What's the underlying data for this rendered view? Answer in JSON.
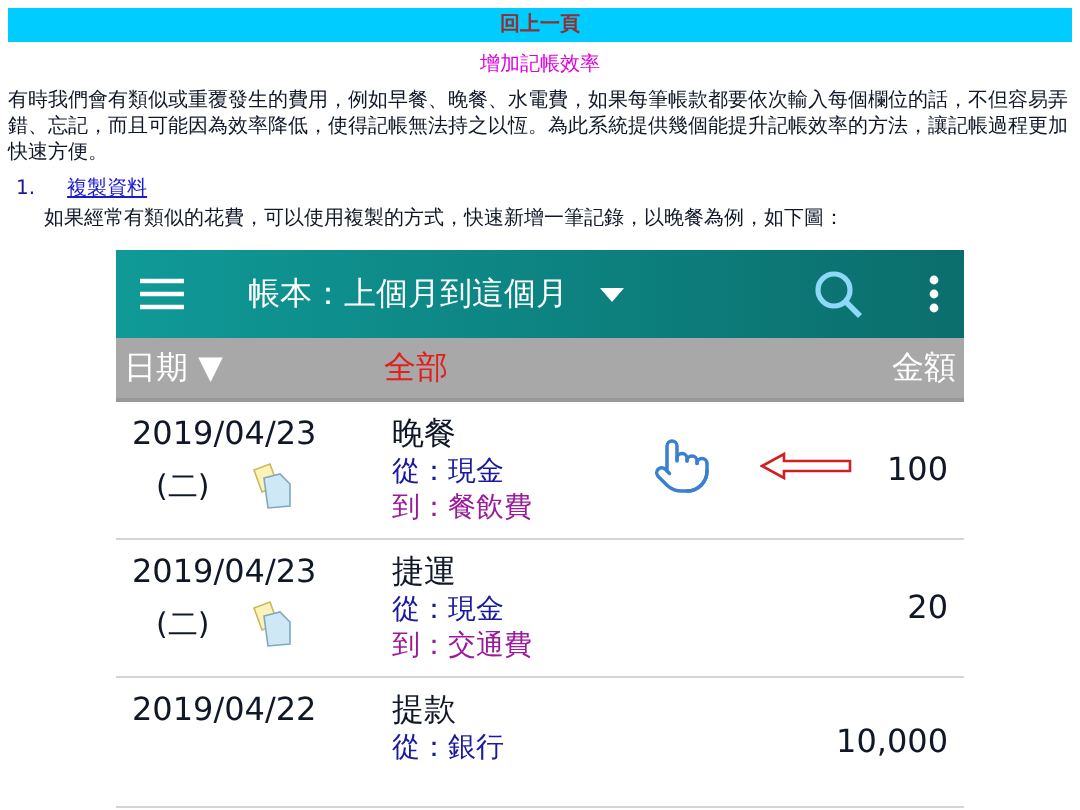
{
  "top_bar": {
    "label": "回上一頁"
  },
  "page_title": "增加記帳效率",
  "intro": "有時我們會有類似或重覆發生的費用，例如早餐、晚餐、水電費，如果每筆帳款都要依次輸入每個欄位的話，不但容易弄錯、忘記，而且可能因為效率降低，使得記帳無法持之以恆。為此系統提供幾個能提升記帳效率的方法，讓記帳過程更加快速方便。",
  "sections": [
    {
      "number": "1.",
      "title": "複製資料",
      "text": "如果經常有類似的花費，可以使用複製的方式，快速新增一筆記錄，以晚餐為例，如下圖："
    }
  ],
  "app": {
    "title": "帳本：上個月到這個月",
    "header": {
      "date": "日期 ▼",
      "filter": "全部",
      "amount": "金額"
    },
    "rows": [
      {
        "date": "2019/04/23",
        "weekday": "(二)",
        "name": "晚餐",
        "from": "從：現金",
        "to": "到：餐飲費",
        "amount": "100",
        "pointer": true
      },
      {
        "date": "2019/04/23",
        "weekday": "(二)",
        "name": "捷運",
        "from": "從：現金",
        "to": "到：交通費",
        "amount": "20",
        "pointer": false
      },
      {
        "date": "2019/04/22",
        "name": "提款",
        "from": "從：銀行",
        "amount": "10,000",
        "pointer": false
      }
    ]
  }
}
